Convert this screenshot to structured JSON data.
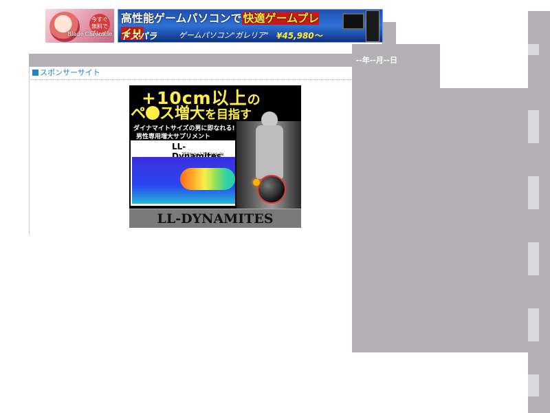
{
  "top_banners": {
    "small": {
      "free_text": "今すぐ無料でプレイ!",
      "logo_text": "Blade Chronicle"
    },
    "big": {
      "headline_prefix": "高性能ゲームパソコンで",
      "headline_highlight": "快適ゲームプレイ!!",
      "brand": "ドスパラ",
      "product": "ゲームパソコン\"ガレリア\"",
      "price": "¥45,980〜"
    }
  },
  "header": {
    "date": "--年--月--日"
  },
  "sponsor": {
    "title": "スポンサーサイト"
  },
  "ad": {
    "headline_1": "+10cm以上",
    "headline_1_suffix": "の",
    "headline_2_a": "ペ",
    "headline_2_b": "ス増大",
    "headline_2_c": "を目指す",
    "sub_1": "ダイナマイトサイズの男に即なれる!",
    "sub_2": "男性専用増大サプリメント",
    "product": "LL-Dynamites",
    "spec": "250mg×120Capsule",
    "footer": "LL-DYNAMITES"
  }
}
